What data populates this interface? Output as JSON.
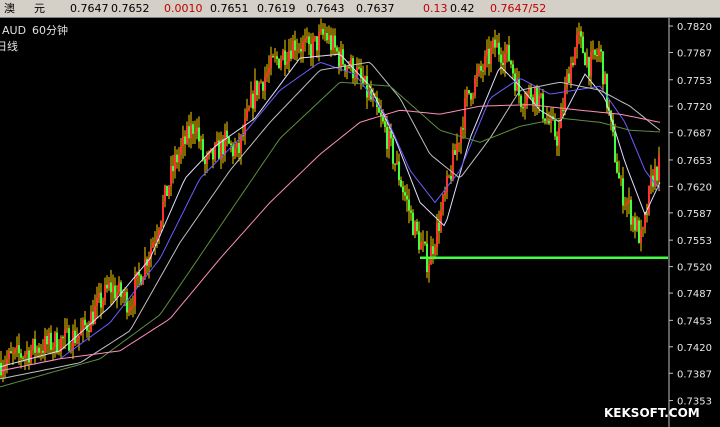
{
  "quote_bar": {
    "label_1": "澳",
    "label_2": "元",
    "open": "0.7647",
    "high": "0.7652",
    "change": "0.0010",
    "bid": "0.7651",
    "low": "0.7619",
    "prev": "0.7643",
    "close": "0.7637",
    "pct": "0.13",
    "amp": "0.42",
    "last": "0.7647/52"
  },
  "chart_header": {
    "symbol": "AUD",
    "period": "60分钟",
    "indicator": "日线"
  },
  "watermark": "KEKSOFT.COM",
  "colors": {
    "background": "#000000",
    "axis": "#c0c0c0",
    "up_candle": "#ff3030",
    "down_candle": "#40ff40",
    "wick": "#ffd000",
    "ma_short": "#e0e0ff",
    "ma_mid1": "#6a5cff",
    "ma_mid2": "#c0c0c0",
    "ma_long1": "#5d8f3f",
    "ma_long2": "#ff8fb8",
    "support_line": "#40ff40"
  },
  "chart_data": {
    "type": "candlestick",
    "title": "",
    "xlabel": "",
    "ylabel": "",
    "ylim": [
      0.732,
      0.783
    ],
    "y_ticks": [
      "0.7820",
      "0.7787",
      "0.7753",
      "0.7720",
      "0.7687",
      "0.7653",
      "0.7620",
      "0.7587",
      "0.7553",
      "0.7520",
      "0.7487",
      "0.7453",
      "0.7420",
      "0.7387",
      "0.7353"
    ],
    "grid": false,
    "price_path": [
      [
        0,
        0.74
      ],
      [
        40,
        0.742
      ],
      [
        80,
        0.7435
      ],
      [
        110,
        0.7495
      ],
      [
        130,
        0.7475
      ],
      [
        155,
        0.756
      ],
      [
        175,
        0.765
      ],
      [
        195,
        0.77
      ],
      [
        205,
        0.7645
      ],
      [
        225,
        0.7675
      ],
      [
        238,
        0.766
      ],
      [
        255,
        0.774
      ],
      [
        275,
        0.7775
      ],
      [
        295,
        0.78
      ],
      [
        310,
        0.779
      ],
      [
        325,
        0.781
      ],
      [
        340,
        0.778
      ],
      [
        355,
        0.7765
      ],
      [
        370,
        0.773
      ],
      [
        385,
        0.769
      ],
      [
        400,
        0.763
      ],
      [
        415,
        0.7565
      ],
      [
        428,
        0.7525
      ],
      [
        440,
        0.758
      ],
      [
        455,
        0.766
      ],
      [
        468,
        0.7735
      ],
      [
        482,
        0.7765
      ],
      [
        495,
        0.7795
      ],
      [
        510,
        0.778
      ],
      [
        520,
        0.773
      ],
      [
        535,
        0.774
      ],
      [
        548,
        0.77
      ],
      [
        558,
        0.768
      ],
      [
        568,
        0.776
      ],
      [
        578,
        0.7805
      ],
      [
        590,
        0.777
      ],
      [
        600,
        0.779
      ],
      [
        610,
        0.77
      ],
      [
        620,
        0.762
      ],
      [
        630,
        0.759
      ],
      [
        642,
        0.755
      ],
      [
        652,
        0.763
      ],
      [
        660,
        0.7647
      ]
    ],
    "moving_averages": [
      {
        "color_key": "ma_short",
        "values": [
          [
            0,
            0.7395
          ],
          [
            60,
            0.7415
          ],
          [
            110,
            0.747
          ],
          [
            150,
            0.753
          ],
          [
            185,
            0.763
          ],
          [
            215,
            0.767
          ],
          [
            255,
            0.7705
          ],
          [
            300,
            0.778
          ],
          [
            340,
            0.7785
          ],
          [
            370,
            0.7745
          ],
          [
            395,
            0.768
          ],
          [
            420,
            0.76
          ],
          [
            445,
            0.757
          ],
          [
            470,
            0.768
          ],
          [
            500,
            0.777
          ],
          [
            520,
            0.7745
          ],
          [
            540,
            0.7715
          ],
          [
            560,
            0.77
          ],
          [
            585,
            0.776
          ],
          [
            605,
            0.773
          ],
          [
            625,
            0.765
          ],
          [
            645,
            0.7585
          ],
          [
            660,
            0.7625
          ]
        ]
      },
      {
        "color_key": "ma_mid1",
        "values": [
          [
            0,
            0.739
          ],
          [
            60,
            0.7405
          ],
          [
            110,
            0.745
          ],
          [
            160,
            0.753
          ],
          [
            200,
            0.763
          ],
          [
            240,
            0.768
          ],
          [
            280,
            0.774
          ],
          [
            320,
            0.7775
          ],
          [
            355,
            0.776
          ],
          [
            385,
            0.771
          ],
          [
            410,
            0.764
          ],
          [
            435,
            0.76
          ],
          [
            460,
            0.764
          ],
          [
            490,
            0.773
          ],
          [
            520,
            0.7755
          ],
          [
            550,
            0.7735
          ],
          [
            575,
            0.774
          ],
          [
            600,
            0.7745
          ],
          [
            625,
            0.77
          ],
          [
            645,
            0.764
          ],
          [
            660,
            0.7615
          ]
        ]
      },
      {
        "color_key": "ma_mid2",
        "values": [
          [
            0,
            0.738
          ],
          [
            80,
            0.74
          ],
          [
            130,
            0.744
          ],
          [
            180,
            0.755
          ],
          [
            230,
            0.764
          ],
          [
            270,
            0.77
          ],
          [
            320,
            0.7765
          ],
          [
            370,
            0.7775
          ],
          [
            400,
            0.773
          ],
          [
            430,
            0.766
          ],
          [
            460,
            0.763
          ],
          [
            490,
            0.768
          ],
          [
            520,
            0.774
          ],
          [
            560,
            0.775
          ],
          [
            600,
            0.774
          ],
          [
            630,
            0.772
          ],
          [
            660,
            0.769
          ]
        ]
      },
      {
        "color_key": "ma_long1",
        "values": [
          [
            0,
            0.737
          ],
          [
            100,
            0.7405
          ],
          [
            160,
            0.746
          ],
          [
            220,
            0.757
          ],
          [
            280,
            0.768
          ],
          [
            340,
            0.775
          ],
          [
            390,
            0.7745
          ],
          [
            440,
            0.769
          ],
          [
            480,
            0.7675
          ],
          [
            520,
            0.7695
          ],
          [
            560,
            0.7705
          ],
          [
            600,
            0.77
          ],
          [
            630,
            0.769
          ],
          [
            660,
            0.7688
          ]
        ]
      },
      {
        "color_key": "ma_long2",
        "values": [
          [
            0,
            0.739
          ],
          [
            60,
            0.7405
          ],
          [
            120,
            0.7415
          ],
          [
            170,
            0.7455
          ],
          [
            220,
            0.753
          ],
          [
            270,
            0.76
          ],
          [
            320,
            0.766
          ],
          [
            360,
            0.77
          ],
          [
            400,
            0.7715
          ],
          [
            440,
            0.771
          ],
          [
            480,
            0.772
          ],
          [
            530,
            0.7722
          ],
          [
            580,
            0.7715
          ],
          [
            620,
            0.771
          ],
          [
            660,
            0.77
          ]
        ]
      }
    ],
    "support_line": {
      "y": 0.7531,
      "x_start": 420,
      "x_end": 668
    }
  }
}
